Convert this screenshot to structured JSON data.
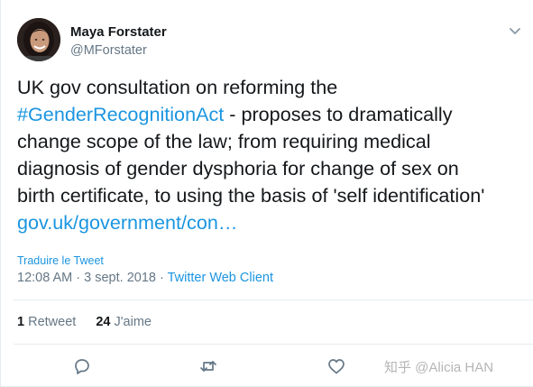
{
  "author": {
    "name": "Maya Forstater",
    "handle": "@MForstater"
  },
  "tweet": {
    "line1": "UK gov consultation on reforming the",
    "hashtag": "#GenderRecognitionAct",
    "line2_rest": " - proposes to dramatically",
    "line3": "change scope of the law; from requiring medical",
    "line4": "diagnosis of gender dysphoria for change of sex on",
    "line5": "birth certificate, to using the basis of 'self identification'",
    "link": "gov.uk/government/con…"
  },
  "translate_label": "Traduire le Tweet",
  "meta": {
    "time_date": "12:08 AM · 3 sept. 2018",
    "separator": " · ",
    "client": "Twitter Web Client"
  },
  "stats": {
    "retweets_count": "1",
    "retweets_label": "Retweet",
    "likes_count": "24",
    "likes_label": "J'aime"
  },
  "actions": [
    "reply-icon",
    "retweet-icon",
    "like-icon",
    "share-icon"
  ],
  "watermark": "知乎 @Alicia HAN",
  "colors": {
    "link": "#1b95e0",
    "text": "#14171a",
    "secondary": "#657786",
    "border": "#e6ecf0"
  }
}
